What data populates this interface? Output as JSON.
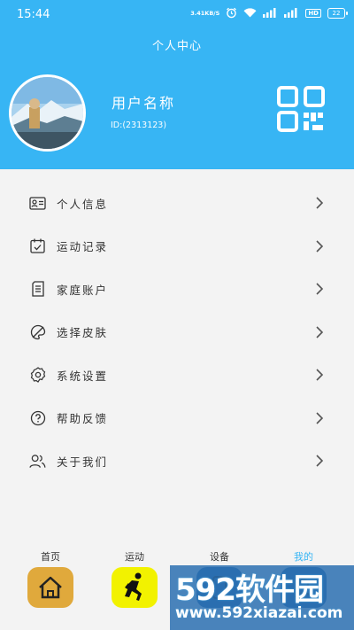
{
  "status_bar": {
    "time": "15:44",
    "speed_top": "3.41",
    "speed_bottom": "KB/S",
    "hd": "HD",
    "battery": "22"
  },
  "header": {
    "title": "个人中心"
  },
  "profile": {
    "username": "用户名称",
    "user_id": "ID:(2313123)"
  },
  "menu": [
    {
      "label": "个人信息",
      "icon": "id-card-icon"
    },
    {
      "label": "运动记录",
      "icon": "calendar-check-icon"
    },
    {
      "label": "家庭账户",
      "icon": "document-icon"
    },
    {
      "label": "选择皮肤",
      "icon": "palette-icon"
    },
    {
      "label": "系统设置",
      "icon": "gear-icon"
    },
    {
      "label": "帮助反馈",
      "icon": "help-icon"
    },
    {
      "label": "关于我们",
      "icon": "users-icon"
    }
  ],
  "tabbar": {
    "tabs": [
      {
        "label": "首页",
        "icon": "home-icon"
      },
      {
        "label": "运动",
        "icon": "running-icon"
      },
      {
        "label": "设备",
        "icon": "device-icon"
      },
      {
        "label": "我的",
        "icon": "profile-icon",
        "active": true
      }
    ]
  },
  "watermark": {
    "brand": "592软件园",
    "url": "www.592xiazai.com"
  },
  "colors": {
    "accent": "#37b5f4",
    "home_tab": "#e0a93c",
    "run_tab": "#f2f200"
  }
}
